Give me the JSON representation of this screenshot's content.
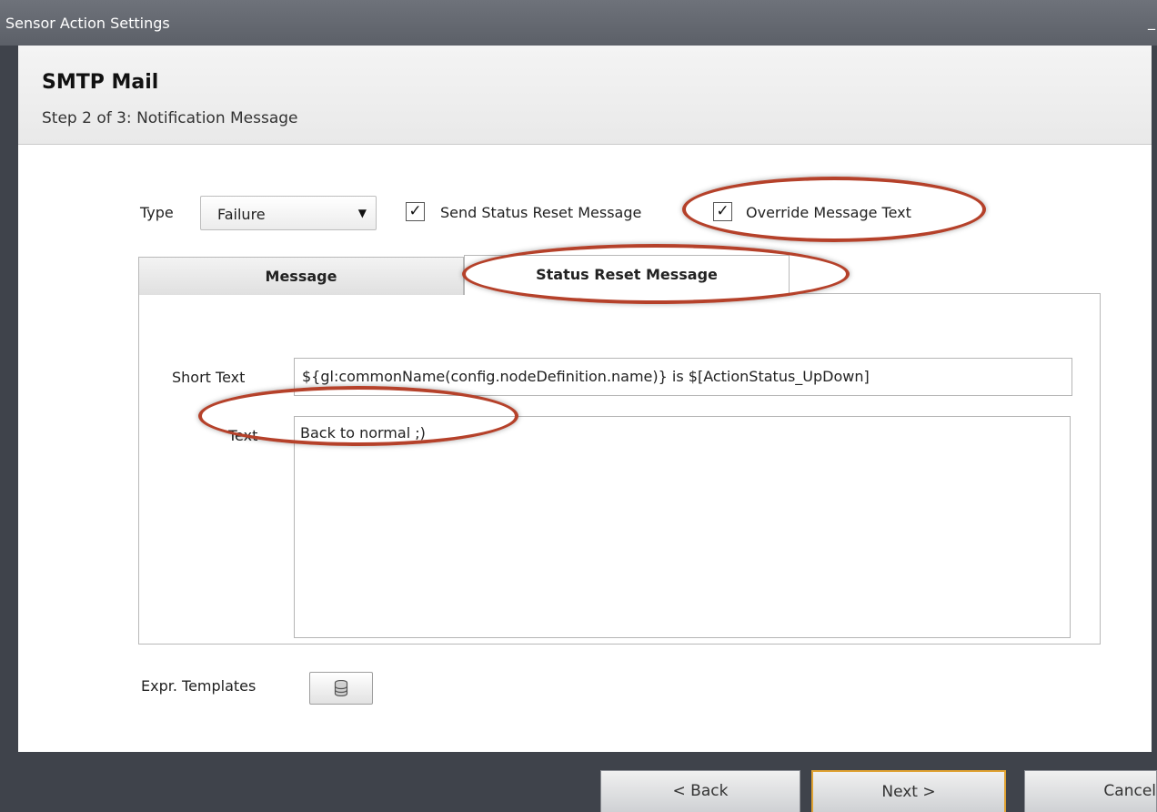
{
  "window": {
    "title": "Sensor Action Settings",
    "minimize_glyph": "_"
  },
  "header": {
    "title": "SMTP Mail",
    "step": "Step 2 of 3: Notification Message"
  },
  "type_row": {
    "type_label": "Type",
    "type_value": "Failure",
    "send_reset_label": "Send Status Reset Message",
    "send_reset_checked": true,
    "override_label": "Override Message Text",
    "override_checked": true,
    "check_glyph": "✓",
    "dropdown_arrow": "▼"
  },
  "tabs": [
    {
      "label": "Message",
      "active": false
    },
    {
      "label": "Status Reset Message",
      "active": true
    }
  ],
  "form": {
    "short_text_label": "Short Text",
    "short_text_value": "${gl:commonName(config.nodeDefinition.name)} is $[ActionStatus_UpDown]",
    "text_label": "Text",
    "text_value": "Back to normal ;)"
  },
  "expr_templates": {
    "label": "Expr. Templates",
    "icon": "database-icon"
  },
  "buttons": {
    "back": "< Back",
    "next": "Next >",
    "cancel": "Cancel"
  },
  "colors": {
    "annotation": "#b5412a",
    "focus_border": "#e0a232",
    "frame": "#3f434b"
  }
}
